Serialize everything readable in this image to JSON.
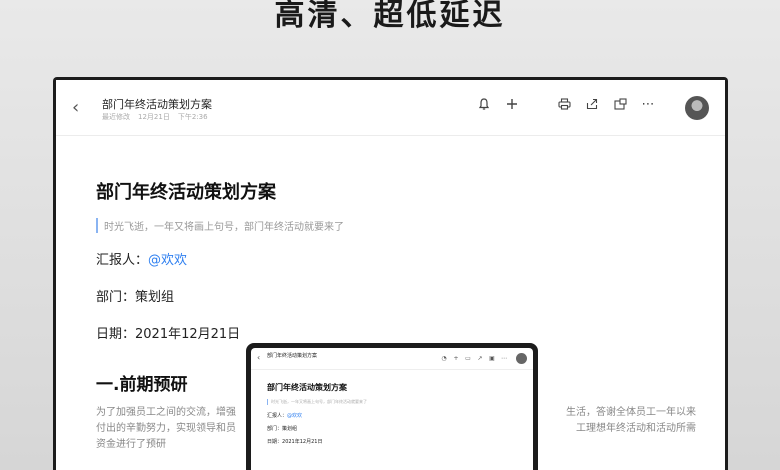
{
  "headline": "高清、超低延迟",
  "doc": {
    "title": "部门年终活动策划方案",
    "meta_edit": "最近修改",
    "meta_date": "12月21日",
    "meta_time": "下午2:36",
    "heading": "部门年终活动策划方案",
    "quote": "时光飞逝，一年又将画上句号，部门年终活动就要来了",
    "reporter_label": "汇报人：",
    "reporter_value": "@欢欢",
    "dept_label": "部门：",
    "dept_value": "策划组",
    "date_label": "日期：",
    "date_value": "2021年12月21日",
    "section_title": "一.前期预研",
    "para_left_1": "为了加强员工之间的交流，增强",
    "para_right_1": "生活，答谢全体员工一年以来",
    "para_left_2": "付出的辛勤努力，实现领导和员",
    "para_right_2": "工理想年终活动和活动所需",
    "para_left_3": "资金进行了预研"
  },
  "icons": {
    "back": "chevron-left-icon",
    "bell": "bell-icon",
    "add": "plus-icon",
    "print": "printer-icon",
    "share": "share-icon",
    "window": "window-icon",
    "more": "more-icon"
  }
}
